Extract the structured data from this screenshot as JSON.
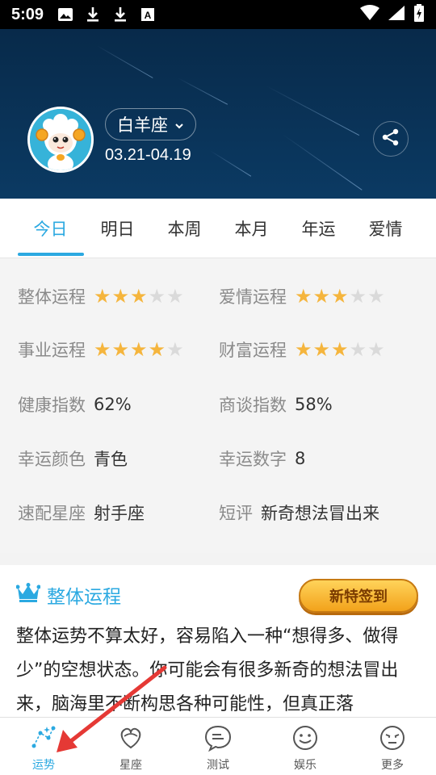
{
  "status_bar": {
    "time": "5:09",
    "icons_left": [
      "image-icon",
      "download-icon",
      "download-icon",
      "font-icon"
    ],
    "icons_right": [
      "wifi-icon",
      "signal-icon",
      "battery-icon"
    ]
  },
  "header": {
    "sign_name": "白羊座",
    "date_range": "03.21-04.19",
    "avatar": "aries-sheep-avatar",
    "share_icon": "share-icon"
  },
  "tabs": [
    {
      "label": "今日",
      "active": true
    },
    {
      "label": "明日",
      "active": false
    },
    {
      "label": "本周",
      "active": false
    },
    {
      "label": "本月",
      "active": false
    },
    {
      "label": "年运",
      "active": false
    },
    {
      "label": "爱情",
      "active": false
    }
  ],
  "fortune": {
    "overall": {
      "label": "整体运程",
      "stars": 3,
      "max": 5
    },
    "love": {
      "label": "爱情运程",
      "stars": 3,
      "max": 5
    },
    "career": {
      "label": "事业运程",
      "stars": 4,
      "max": 5
    },
    "wealth": {
      "label": "财富运程",
      "stars": 3,
      "max": 5
    },
    "health": {
      "label": "健康指数",
      "value": "62%"
    },
    "negotiation": {
      "label": "商谈指数",
      "value": "58%"
    },
    "lucky_color": {
      "label": "幸运颜色",
      "value": "青色"
    },
    "lucky_number": {
      "label": "幸运数字",
      "value": "8"
    },
    "match_sign": {
      "label": "速配星座",
      "value": "射手座"
    },
    "comment": {
      "label": "短评",
      "value": "新奇想法冒出来"
    }
  },
  "detail": {
    "title": "整体运程",
    "checkin_label": "新特签到",
    "text": "整体运势不算太好，容易陷入一种“想得多、做得少”的空想状态。你可能会有很多新奇的想法冒出来，脑海里不断构思各种可能性，但真正落"
  },
  "bottom_nav": [
    {
      "label": "运势",
      "icon": "fortune-icon",
      "active": true
    },
    {
      "label": "星座",
      "icon": "constellation-icon",
      "active": false
    },
    {
      "label": "测试",
      "icon": "test-icon",
      "active": false
    },
    {
      "label": "娱乐",
      "icon": "entertainment-icon",
      "active": false
    },
    {
      "label": "更多",
      "icon": "more-icon",
      "active": false
    }
  ],
  "colors": {
    "accent": "#2ba9e1",
    "star_on": "#f5b53d",
    "star_off": "#dadada",
    "header_bg": "#0b3a63",
    "annotation_arrow": "#e53935"
  }
}
